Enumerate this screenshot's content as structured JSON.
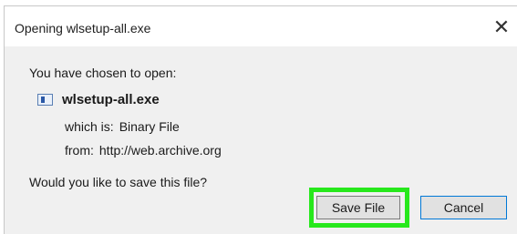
{
  "dialog": {
    "title": "Opening wlsetup-all.exe",
    "intro": "You have chosen to open:",
    "file_name": "wlsetup-all.exe",
    "which_is_label": "which is:",
    "which_is_value": "Binary File",
    "from_label": "from:",
    "from_value": "http://web.archive.org",
    "question": "Would you like to save this file?",
    "save_label": "Save File",
    "cancel_label": "Cancel",
    "close_glyph": "✕"
  },
  "colors": {
    "highlight": "#27e81c",
    "default_button_border": "#0078d7",
    "background": "#f0f0f0"
  },
  "icons": {
    "file": "application-file-icon",
    "close": "close-icon"
  }
}
